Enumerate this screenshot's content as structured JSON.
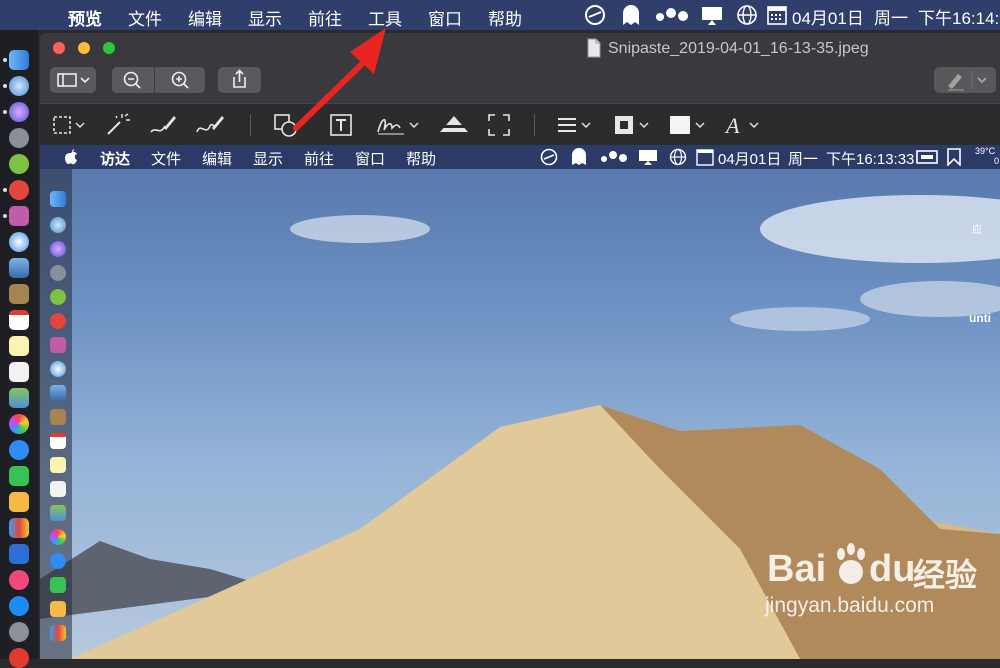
{
  "menubar": {
    "apple": "",
    "items": [
      "预览",
      "文件",
      "编辑",
      "显示",
      "前往",
      "工具",
      "窗口",
      "帮助"
    ],
    "status_date": "04月01日",
    "status_day": "周一",
    "status_time": "下午16:14:"
  },
  "window": {
    "title": "Snipaste_2019-04-01_16-13-35.jpeg"
  },
  "inner": {
    "menu_items": [
      "访达",
      "文件",
      "编辑",
      "显示",
      "前往",
      "窗口",
      "帮助"
    ],
    "status_date": "04月01日",
    "status_day": "周一",
    "status_time": "下午16:13:33",
    "temp": "39°C",
    "temp_sub": "0",
    "right_text_1": "应",
    "right_text_2": "unti"
  },
  "watermark": {
    "brand_a": "Bai",
    "brand_b": "du",
    "brand_cn": "经验",
    "url": "jingyan.baidu.com"
  },
  "colors": {
    "arrow": "#e8251f",
    "close": "#fe5f57",
    "minimize": "#febc2e",
    "zoom": "#28c840"
  }
}
